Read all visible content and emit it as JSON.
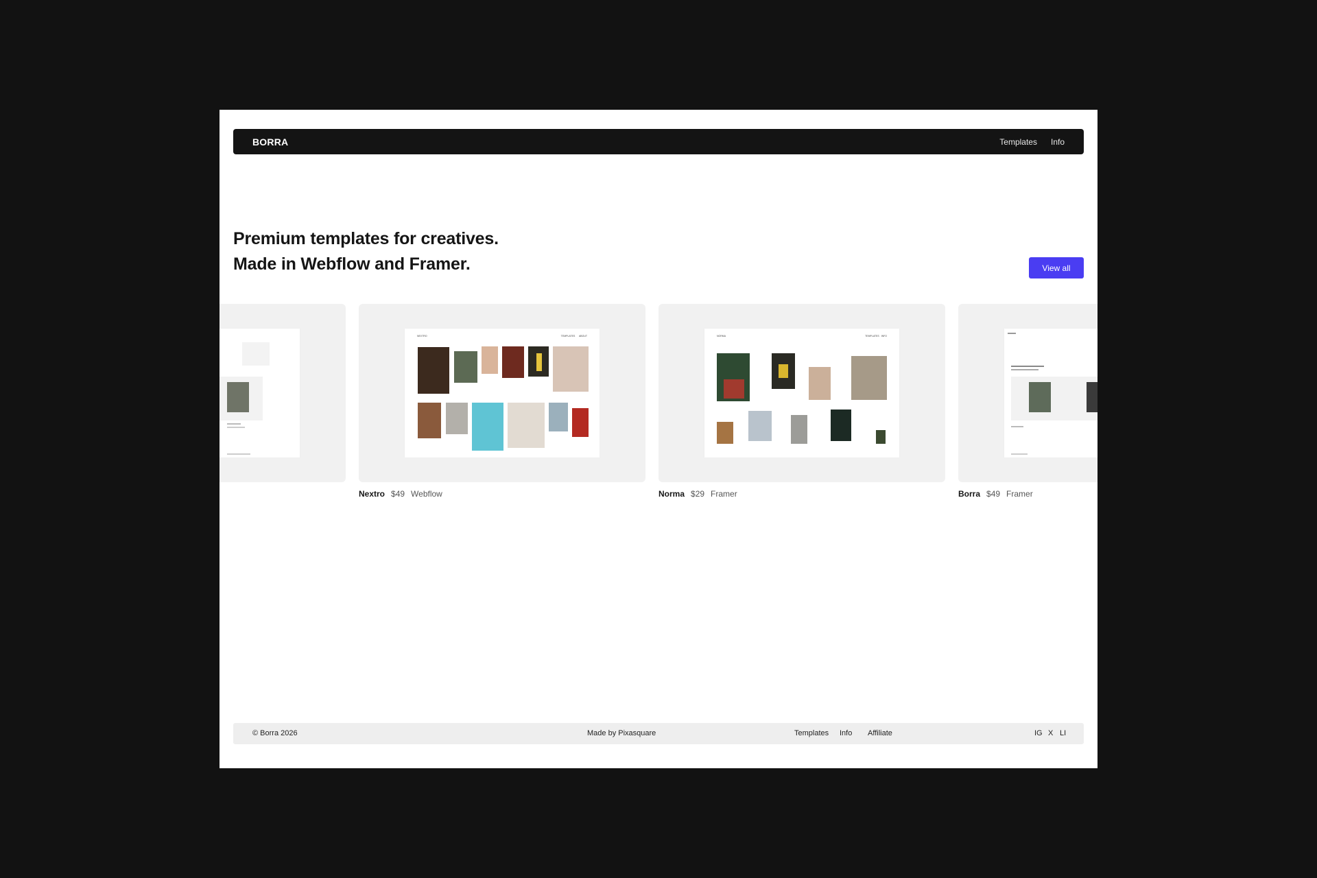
{
  "nav": {
    "brand": "BORRA",
    "links": [
      "Templates",
      "Info"
    ]
  },
  "hero": {
    "line1": "Premium templates for creatives.",
    "line2": "Made in Webflow and Framer.",
    "cta": "View all"
  },
  "templates": [
    {
      "name": "Nextro",
      "price": "$49",
      "platform": "Webflow"
    },
    {
      "name": "Norma",
      "price": "$29",
      "platform": "Framer"
    },
    {
      "name": "Borra",
      "price": "$49",
      "platform": "Framer"
    }
  ],
  "footer": {
    "copyright": "© Borra 2026",
    "credit": "Made by Pixasquare",
    "links": [
      "Templates",
      "Info",
      "Affiliate"
    ],
    "social": [
      "IG",
      "X",
      "LI"
    ]
  },
  "colors": {
    "accent": "#4a3df2",
    "nav_bg": "#141414",
    "card_bg": "#f1f1f1",
    "footer_bg": "#eeeeee",
    "page_bg": "#121212"
  }
}
